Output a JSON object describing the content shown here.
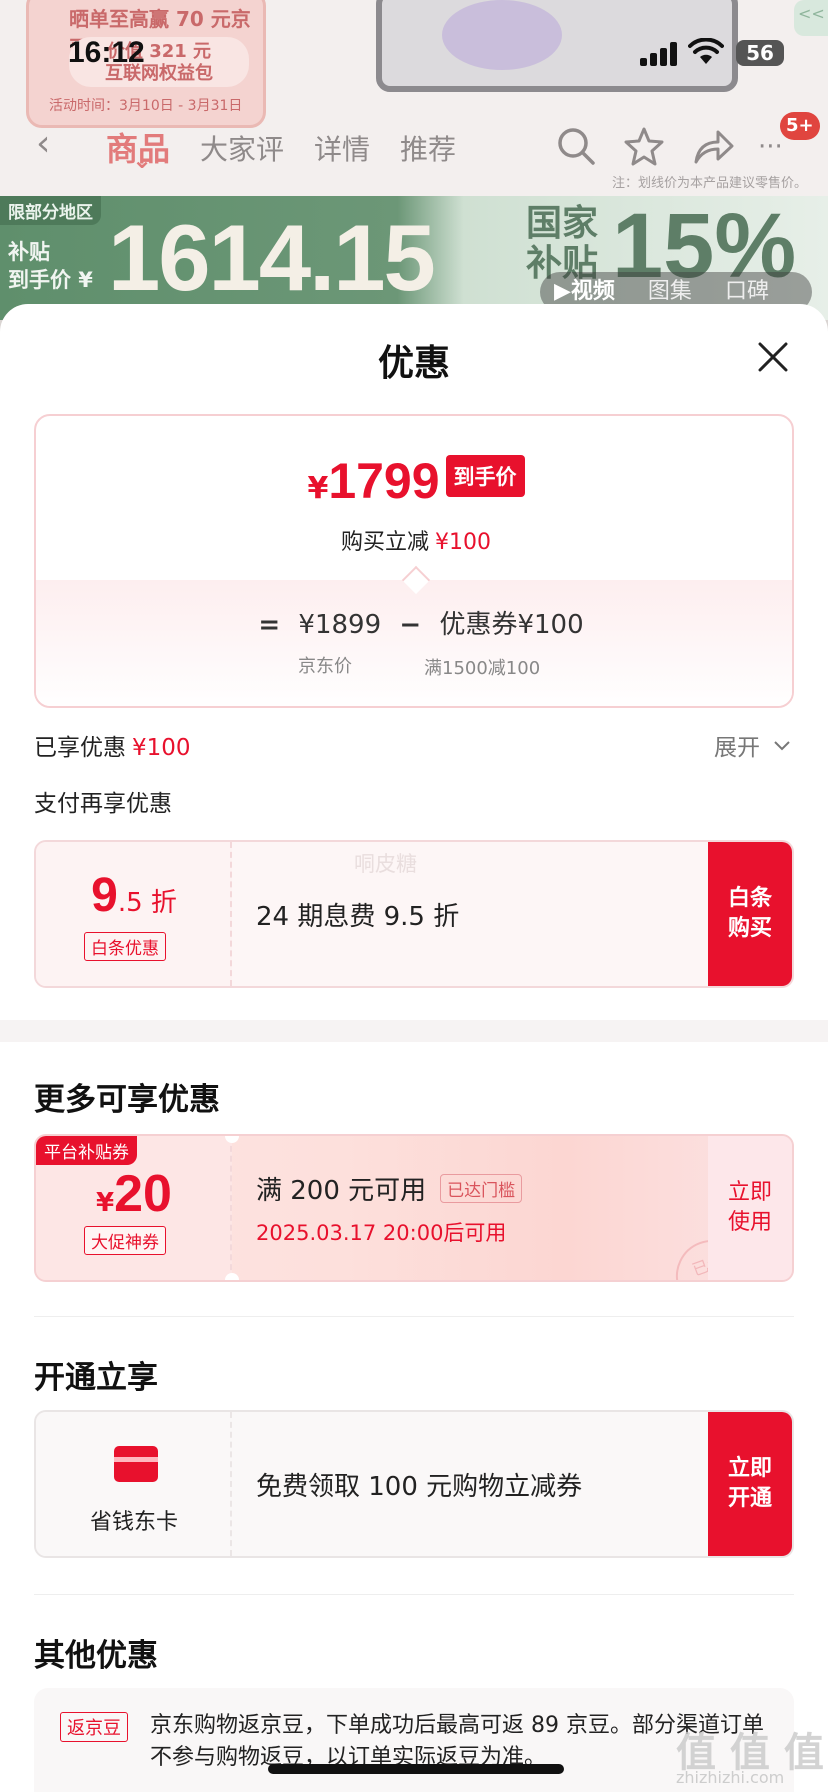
{
  "status_bar": {
    "time": "16:12",
    "battery": "56"
  },
  "bg": {
    "promo_line1": "晒单至高赢 70 元京豆",
    "promo_line2a": "价值 321 元",
    "promo_line2b": "互联网权益包",
    "promo_line3": "活动时间：3月10日 - 3月31日",
    "side_tab": "<<",
    "nav_tabs": [
      "商品",
      "大家评",
      "详情",
      "推荐"
    ],
    "cart_badge": "5+",
    "price_note": "注：划线价为本产品建议零售价。",
    "region_tag": "限部分地区",
    "sub_line1": "补贴",
    "sub_line2": "到手价 ¥",
    "subsidy_price": "1614.15",
    "gov_label": "国家补贴",
    "gov_pct": "15%",
    "media_tabs": [
      "▶视频",
      "图集",
      "口碑"
    ]
  },
  "sheet": {
    "title": "优惠",
    "final_price": {
      "currency": "¥",
      "value": "1799",
      "label": "到手价"
    },
    "reduce_text": "购买立减",
    "reduce_amount": "¥100",
    "formula": {
      "eq": "=",
      "base": "¥1899",
      "minus": "−",
      "coupon": "优惠券¥100",
      "base_label": "京东价",
      "coupon_label": "满1500减100"
    },
    "enjoyed_label": "已享优惠",
    "enjoyed_amount": "¥100",
    "expand_label": "展开",
    "pay_title": "支付再享优惠",
    "baitiao": {
      "disc_num": "9",
      "disc_unit": ".5 折",
      "tag": "白条优惠",
      "desc": "24 期息费 9.5 折",
      "watermark": "哃皮糖",
      "cta": "白条购买"
    },
    "more_title": "更多可享优惠",
    "coupon": {
      "tag": "平台补贴券",
      "currency": "¥",
      "value": "20",
      "type": "大促神券",
      "condition": "满 200 元可用",
      "reached": "已达门槛",
      "available": "2025.03.17 20:00后可用",
      "stamp": "已领",
      "cta": "立即使用"
    },
    "open_title": "开通立享",
    "card": {
      "name": "省钱东卡",
      "desc": "免费领取 100 元购物立减券",
      "cta": "立即开通"
    },
    "other_title": "其他优惠",
    "other": {
      "tag": "返京豆",
      "text": "京东购物返京豆，下单成功后最高可返 89 京豆。部分渠道订单不参与购物返豆，以订单实际返豆为准。"
    }
  },
  "watermark": {
    "mark": "值 值 值",
    "url": "zhizhizhi.com"
  },
  "colors": {
    "accent": "#e8112d",
    "accent_light": "#fde7ea",
    "subsidy_green": "#5f8f6c"
  }
}
